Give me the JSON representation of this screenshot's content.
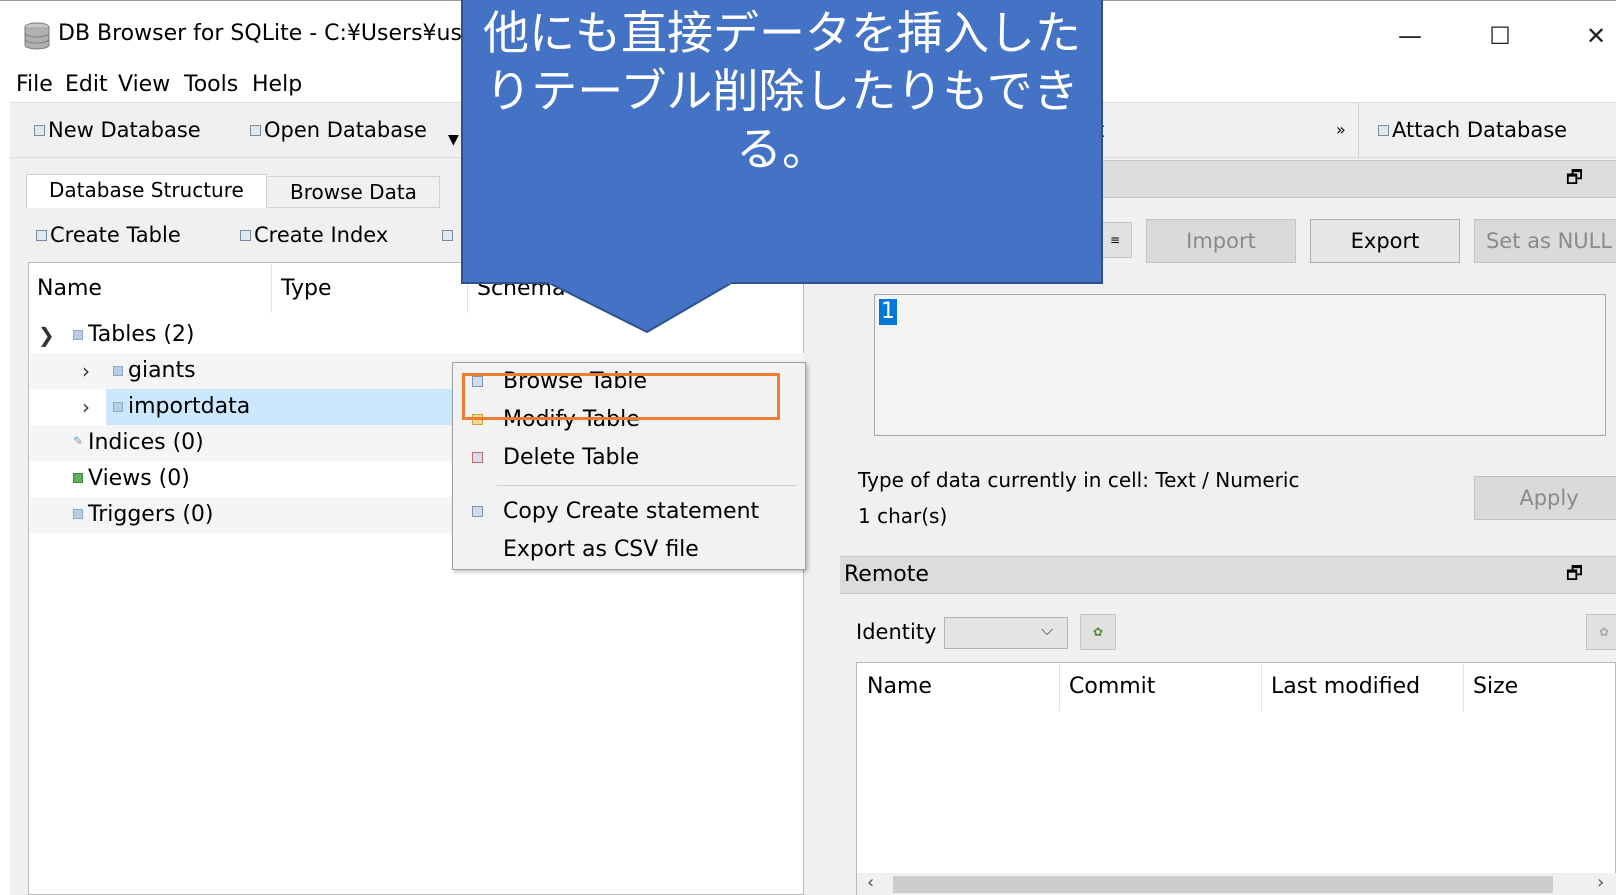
{
  "window": {
    "title": "DB Browser for SQLite - C:¥Users¥use",
    "minimize_glyph": "—",
    "maximize_glyph": "☐",
    "close_glyph": "✕"
  },
  "menubar": [
    "File",
    "Edit",
    "View",
    "Tools",
    "Help"
  ],
  "toolbar": {
    "new_database": "New Database",
    "open_database": "Open Database",
    "partial_item": "t",
    "overflow": "»",
    "attach_database": "Attach Database"
  },
  "left_tabs": {
    "structure": "Database Structure",
    "browse": "Browse Data"
  },
  "structure_toolbar": {
    "create_table": "Create Table",
    "create_index": "Create Index"
  },
  "tree": {
    "headers": {
      "name": "Name",
      "type": "Type",
      "schema": "Schema"
    },
    "tables": "Tables (2)",
    "giants": "giants",
    "importdata": "importdata",
    "indices": "Indices (0)",
    "views": "Views (0)",
    "triggers": "Triggers (0)"
  },
  "context_menu": {
    "browse_table": "Browse Table",
    "modify_table": "Modify Table",
    "delete_table": "Delete Table",
    "copy_create": "Copy Create statement",
    "export_csv": "Export as CSV file"
  },
  "edit_cell": {
    "import": "Import",
    "export": "Export",
    "set_null": "Set as NULL",
    "value": "1",
    "type_info": "Type of data currently in cell: Text / Numeric",
    "size_info": "1 char(s)",
    "apply": "Apply"
  },
  "remote": {
    "title": "Remote",
    "identity_label": "Identity",
    "columns": {
      "name": "Name",
      "commit": "Commit",
      "last_modified": "Last modified",
      "size": "Size"
    }
  },
  "callout": {
    "text": "他にも直接データを挿入したりテーブル削除したりもできる。"
  },
  "colors": {
    "callout": "#4472c4",
    "highlight": "#ed7d31",
    "selection": "#cce8ff"
  }
}
